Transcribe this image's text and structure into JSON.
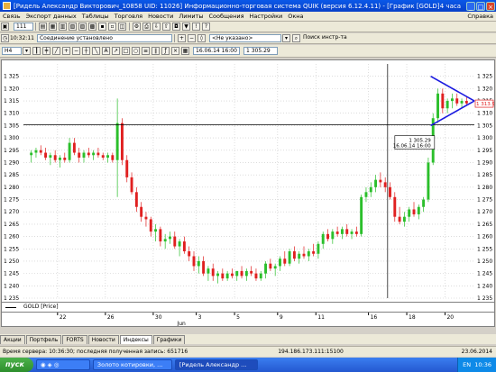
{
  "window": {
    "title": "[Ридель Александр Викторович_10858 UID: 11026] Информационно-торговая система QUIK (версия 6.12.4.11) - [График [GOLD]]",
    "time_label": "4 часа"
  },
  "menu": {
    "items": [
      "Связь",
      "Экспорт данных",
      "Таблицы",
      "Торговля",
      "Новости",
      "Лимиты",
      "Сообщения",
      "Настройки",
      "Окна"
    ],
    "help": "Справка"
  },
  "toolbar1": {
    "counter": "111"
  },
  "toolbar2": {
    "time": "10:32:11",
    "connection": "Соединение установлено",
    "client_select": "<Не указано>",
    "search_placeholder": "Поиск инстр-та"
  },
  "toolbar3": {
    "interval": "H4",
    "cursor_time": "16.06.14 16:00",
    "cursor_price": "1 305.29"
  },
  "chart_data": {
    "type": "candlestick",
    "instrument": "GOLD",
    "legend": "GOLD [Price]",
    "ylim": [
      1235,
      1330
    ],
    "y_ticks": [
      "1 325",
      "1 320",
      "1 315",
      "1 310",
      "1 305",
      "1 300",
      "1 295",
      "1 290",
      "1 285",
      "1 280",
      "1 275",
      "1 270",
      "1 265",
      "1 260",
      "1 255",
      "1 250",
      "1 245",
      "1 240",
      "1 235"
    ],
    "x_ticks": [
      "22",
      "26",
      "30",
      "3",
      "5",
      "9",
      "11",
      "16",
      "18",
      "20"
    ],
    "x_month_label": "Jun",
    "last_price_label": "1 313.90",
    "crosshair": {
      "price": 1305.29,
      "price_label": "1 305.29",
      "time_label": "16.06.14 16:00"
    },
    "candles": [
      [
        1293,
        1295,
        1290,
        1294
      ],
      [
        1294,
        1296,
        1292,
        1295
      ],
      [
        1295,
        1297,
        1293,
        1294
      ],
      [
        1294,
        1296,
        1291,
        1292
      ],
      [
        1292,
        1294,
        1289,
        1293
      ],
      [
        1293,
        1295,
        1290,
        1291
      ],
      [
        1291,
        1293,
        1288,
        1292
      ],
      [
        1292,
        1294,
        1290,
        1291
      ],
      [
        1291,
        1300,
        1290,
        1298
      ],
      [
        1298,
        1300,
        1293,
        1294
      ],
      [
        1294,
        1296,
        1290,
        1292
      ],
      [
        1292,
        1295,
        1290,
        1294
      ],
      [
        1294,
        1296,
        1292,
        1293
      ],
      [
        1293,
        1295,
        1291,
        1294
      ],
      [
        1294,
        1296,
        1292,
        1293
      ],
      [
        1293,
        1294,
        1291,
        1292
      ],
      [
        1292,
        1294,
        1290,
        1293
      ],
      [
        1293,
        1294,
        1290,
        1291
      ],
      [
        1291,
        1316,
        1276,
        1306
      ],
      [
        1306,
        1308,
        1289,
        1291
      ],
      [
        1291,
        1293,
        1282,
        1284
      ],
      [
        1284,
        1286,
        1277,
        1278
      ],
      [
        1278,
        1280,
        1270,
        1272
      ],
      [
        1272,
        1274,
        1266,
        1268
      ],
      [
        1268,
        1270,
        1264,
        1267
      ],
      [
        1267,
        1268,
        1260,
        1262
      ],
      [
        1262,
        1265,
        1258,
        1263
      ],
      [
        1263,
        1264,
        1256,
        1258
      ],
      [
        1258,
        1261,
        1255,
        1259
      ],
      [
        1259,
        1262,
        1257,
        1260
      ],
      [
        1260,
        1262,
        1255,
        1256
      ],
      [
        1256,
        1259,
        1252,
        1258
      ],
      [
        1258,
        1260,
        1253,
        1254
      ],
      [
        1254,
        1256,
        1250,
        1252
      ],
      [
        1252,
        1254,
        1246,
        1248
      ],
      [
        1248,
        1252,
        1245,
        1250
      ],
      [
        1250,
        1252,
        1244,
        1245
      ],
      [
        1245,
        1248,
        1242,
        1247
      ],
      [
        1247,
        1249,
        1242,
        1244
      ],
      [
        1244,
        1246,
        1241,
        1245
      ],
      [
        1245,
        1247,
        1242,
        1243
      ],
      [
        1243,
        1246,
        1242,
        1245
      ],
      [
        1245,
        1247,
        1243,
        1244
      ],
      [
        1244,
        1246,
        1242,
        1246
      ],
      [
        1246,
        1248,
        1243,
        1244
      ],
      [
        1244,
        1247,
        1242,
        1246
      ],
      [
        1246,
        1248,
        1244,
        1245
      ],
      [
        1245,
        1247,
        1242,
        1243
      ],
      [
        1243,
        1246,
        1242,
        1245
      ],
      [
        1245,
        1250,
        1243,
        1249
      ],
      [
        1249,
        1251,
        1246,
        1247
      ],
      [
        1247,
        1249,
        1244,
        1248
      ],
      [
        1248,
        1252,
        1246,
        1251
      ],
      [
        1251,
        1254,
        1248,
        1249
      ],
      [
        1249,
        1255,
        1248,
        1254
      ],
      [
        1254,
        1256,
        1250,
        1251
      ],
      [
        1251,
        1254,
        1249,
        1253
      ],
      [
        1253,
        1256,
        1251,
        1252
      ],
      [
        1252,
        1255,
        1250,
        1254
      ],
      [
        1254,
        1257,
        1252,
        1253
      ],
      [
        1253,
        1258,
        1251,
        1257
      ],
      [
        1257,
        1262,
        1255,
        1261
      ],
      [
        1261,
        1263,
        1258,
        1259
      ],
      [
        1259,
        1263,
        1257,
        1262
      ],
      [
        1262,
        1264,
        1260,
        1261
      ],
      [
        1261,
        1264,
        1259,
        1263
      ],
      [
        1263,
        1265,
        1260,
        1261
      ],
      [
        1261,
        1263,
        1259,
        1262
      ],
      [
        1262,
        1264,
        1260,
        1261
      ],
      [
        1261,
        1277,
        1260,
        1276
      ],
      [
        1276,
        1280,
        1274,
        1278
      ],
      [
        1278,
        1282,
        1276,
        1280
      ],
      [
        1280,
        1285,
        1278,
        1283
      ],
      [
        1283,
        1286,
        1280,
        1282
      ],
      [
        1282,
        1284,
        1278,
        1280
      ],
      [
        1280,
        1282,
        1275,
        1276
      ],
      [
        1276,
        1278,
        1266,
        1268
      ],
      [
        1268,
        1272,
        1265,
        1266
      ],
      [
        1266,
        1270,
        1264,
        1268
      ],
      [
        1268,
        1272,
        1266,
        1271
      ],
      [
        1271,
        1274,
        1268,
        1269
      ],
      [
        1269,
        1273,
        1267,
        1272
      ],
      [
        1272,
        1276,
        1270,
        1275
      ],
      [
        1275,
        1292,
        1274,
        1290
      ],
      [
        1290,
        1310,
        1289,
        1308
      ],
      [
        1308,
        1320,
        1306,
        1318
      ],
      [
        1318,
        1320,
        1310,
        1312
      ],
      [
        1312,
        1316,
        1310,
        1315
      ],
      [
        1315,
        1318,
        1312,
        1316
      ],
      [
        1316,
        1318,
        1313,
        1314
      ],
      [
        1314,
        1316,
        1312,
        1315
      ],
      [
        1315,
        1317,
        1313,
        1314
      ]
    ]
  }
}
